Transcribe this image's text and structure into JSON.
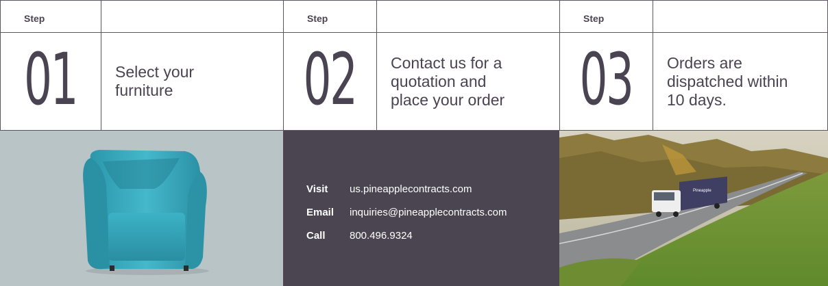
{
  "steps": [
    {
      "label": "Step",
      "number": "01",
      "text": "Select your furniture"
    },
    {
      "label": "Step",
      "number": "02",
      "text": "Contact us for a quotation and place your order"
    },
    {
      "label": "Step",
      "number": "03",
      "text": "Orders are dispatched within 10 days."
    }
  ],
  "contact": {
    "visit_label": "Visit",
    "visit_value": "us.pineapplecontracts.com",
    "email_label": "Email",
    "email_value": "inquiries@pineapplecontracts.com",
    "call_label": "Call",
    "call_value": "800.496.9324"
  },
  "truck_brand": "Pineapple",
  "colors": {
    "text": "#4a4452",
    "panel": "#4b4451",
    "chair": "#2f9fb3",
    "chair_bg": "#b9c4c7"
  }
}
